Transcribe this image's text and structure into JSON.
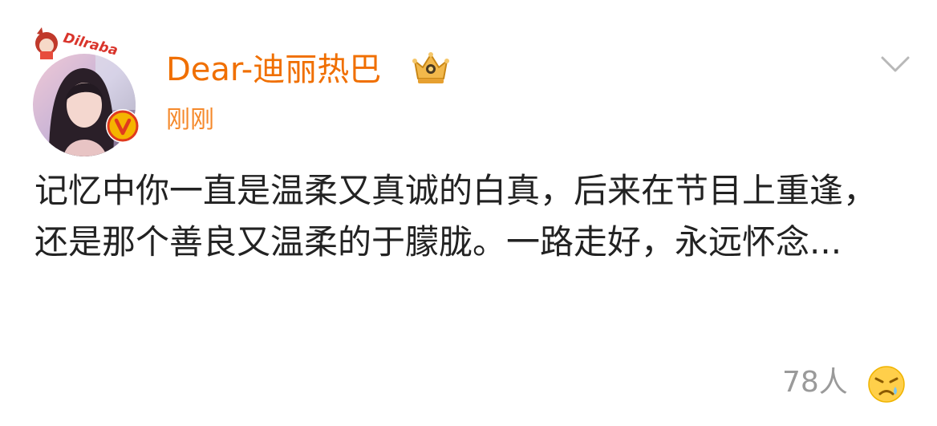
{
  "post": {
    "author_name": "Dear-迪丽热巴",
    "avatar_frame_text": "Dilraba",
    "timestamp": "刚刚",
    "body_text": "记忆中你一直是温柔又真诚的白真，后来在节目上重逢，还是那个善良又温柔的于朦胧。一路走好，永远怀念...",
    "reaction_count": "78人"
  },
  "icons": {
    "member": "crown-icon",
    "verified": "verified-v-icon",
    "menu": "chevron-down-icon",
    "reaction": "sad-face-icon"
  },
  "colors": {
    "author_name": "#f06f00",
    "timestamp": "#f5892b",
    "body": "#222222",
    "muted": "#9a9a9a",
    "badge": "#f5b400",
    "badge_ring": "#e03a1e"
  }
}
